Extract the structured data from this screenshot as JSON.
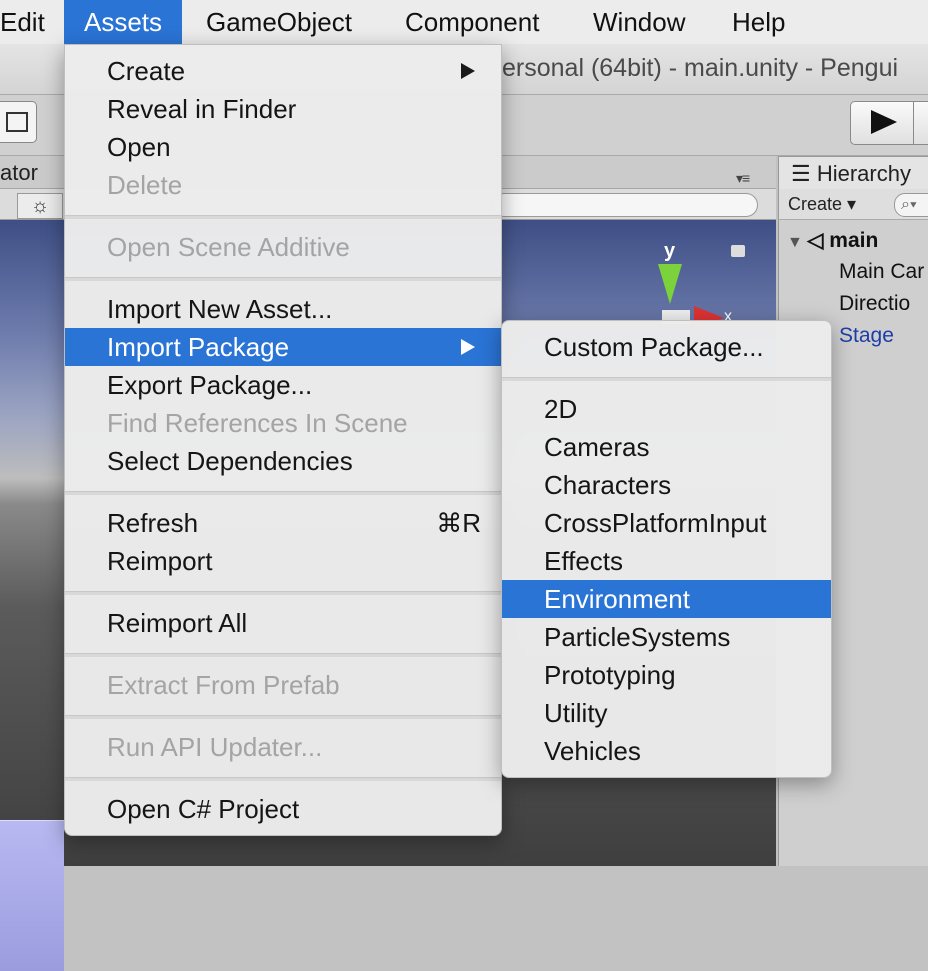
{
  "menubar": {
    "items": [
      "Edit",
      "Assets",
      "GameObject",
      "Component",
      "Window",
      "Help"
    ],
    "active": "Assets"
  },
  "window": {
    "title": "ersonal (64bit) - main.unity - Pengui"
  },
  "scene": {
    "tab_label": "ator",
    "panel_menu": "▾≡",
    "sun_icon_glyph": "☼",
    "gizmo_y_label": "y",
    "gizmo_x_label": "x"
  },
  "hierarchy": {
    "tab_label": "Hierarchy",
    "create_label": "Create ▾",
    "search_glyph": "⌕▾",
    "scene_name": "main",
    "rows": [
      "Main Car",
      "Directio",
      "Stage"
    ]
  },
  "assets_menu": {
    "items": [
      {
        "label": "Create",
        "submenu": true
      },
      {
        "label": "Reveal in Finder"
      },
      {
        "label": "Open"
      },
      {
        "label": "Delete",
        "disabled": true
      },
      {
        "label": "Open Scene Additive",
        "disabled": true
      },
      {
        "label": "Import New Asset..."
      },
      {
        "label": "Import Package",
        "submenu": true,
        "highlighted": true
      },
      {
        "label": "Export Package..."
      },
      {
        "label": "Find References In Scene",
        "disabled": true
      },
      {
        "label": "Select Dependencies"
      },
      {
        "label": "Refresh",
        "shortcut": "⌘R"
      },
      {
        "label": "Reimport"
      },
      {
        "label": "Reimport All"
      },
      {
        "label": "Extract From Prefab",
        "disabled": true
      },
      {
        "label": "Run API Updater...",
        "disabled": true
      },
      {
        "label": "Open C# Project"
      }
    ]
  },
  "import_package_menu": {
    "items": [
      {
        "label": "Custom Package..."
      },
      {
        "label": "2D"
      },
      {
        "label": "Cameras"
      },
      {
        "label": "Characters"
      },
      {
        "label": "CrossPlatformInput"
      },
      {
        "label": "Effects"
      },
      {
        "label": "Environment",
        "highlighted": true
      },
      {
        "label": "ParticleSystems"
      },
      {
        "label": "Prototyping"
      },
      {
        "label": "Utility"
      },
      {
        "label": "Vehicles"
      }
    ]
  },
  "colors": {
    "highlight": "#2a74d6",
    "menu_bg": "#ececec",
    "disabled_text": "#a4a4a4"
  }
}
